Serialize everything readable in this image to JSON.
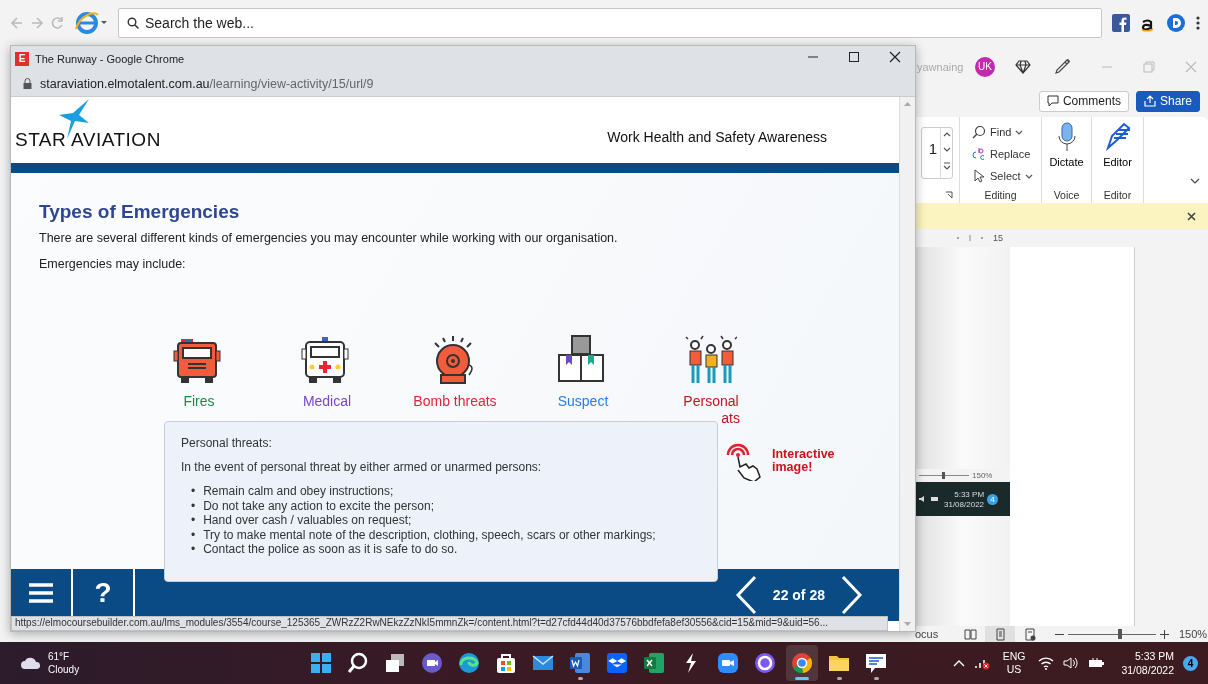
{
  "browser_toolbar": {
    "search": {
      "placeholder": "Search the web..."
    }
  },
  "word": {
    "user": "yawnaing",
    "avatar": "UK",
    "buttons": [
      {
        "label": "Comments",
        "kind": "outline"
      },
      {
        "label": "Share",
        "kind": "primary"
      }
    ],
    "spin_value": "1",
    "editing": {
      "items": [
        {
          "label": "Find",
          "kind": "find",
          "dropdown": true
        },
        {
          "label": "Replace",
          "kind": "replace",
          "dropdown": false
        },
        {
          "label": "Select",
          "kind": "select",
          "dropdown": true
        }
      ],
      "group": "Editing"
    },
    "voice": {
      "label": "Dictate",
      "group": "Voice"
    },
    "editor": {
      "label": "Editor",
      "group": "Editor"
    },
    "ruler_mark": "15",
    "embedded": {
      "zoom": "150%",
      "level": 0.45,
      "time": "5:33 PM",
      "date": "31/08/2022",
      "badge": "4"
    },
    "status": {
      "focus": "ocus",
      "views": [
        {
          "selected": false
        },
        {
          "selected": true
        },
        {
          "selected": false
        }
      ],
      "level": 0.57,
      "zoom": "150%"
    }
  },
  "chrome": {
    "favicon": "E",
    "title": "The Runway - Google Chrome",
    "url_domain": "staraviation.elmotalent.com.au",
    "url_path": "/learning/view-activity/15/url/9",
    "page": {
      "brand": "STAR AVIATION",
      "course_title": "Work Health and Safety Awareness",
      "heading": "Types of Emergencies",
      "paragraphs": [
        "There are several different kinds of emergencies you may encounter while working with our organisation.",
        "Emergencies may include:"
      ],
      "items": [
        {
          "kind": "fire",
          "lines": [
            "Fires"
          ],
          "color": "#1a8a4a"
        },
        {
          "kind": "medical",
          "lines": [
            "Medical"
          ],
          "color": "#7a45c8"
        },
        {
          "kind": "bomb",
          "lines": [
            "Bomb threats"
          ],
          "color": "#e0243c"
        },
        {
          "kind": "suspect",
          "lines": [
            "Suspect"
          ],
          "color": "#2a7de0"
        },
        {
          "kind": "personal",
          "lines": [
            "Personal",
            "ats"
          ],
          "color": "#c21420"
        }
      ],
      "tooltip": {
        "title": "Personal threats:",
        "intro": "In the event of personal threat by either armed or unarmed persons:",
        "bullet": "•",
        "bullets": [
          "Remain calm and obey instructions;",
          "Do not take any action to excite the person;",
          "Hand over cash / valuables on request;",
          "Try to make mental note of the description, clothing, speech, scars or other markings;",
          "Contact the police as soon as it is safe to do so."
        ]
      },
      "interactive": "Interactive image!",
      "nav": {
        "help": "?",
        "page": "22 of 28"
      }
    },
    "status_url": "https://elmocoursebuilder.com.au/lms_modules/3554/course_125365_ZWRzZ2RwNEkzZzNkI5mmnZk=/content.html?t=d27cfd44d40d37576bbdfefa8ef30556&cid=15&mid=9&uid=56..."
  },
  "taskbar": {
    "temp": "61°F",
    "condition": "Cloudy",
    "apps": [
      {
        "kind": "start",
        "running": false,
        "selected": false
      },
      {
        "kind": "search",
        "running": false,
        "selected": false
      },
      {
        "kind": "taskview",
        "running": false,
        "selected": false
      },
      {
        "kind": "teams",
        "running": false,
        "selected": false
      },
      {
        "kind": "edge",
        "running": false,
        "selected": false
      },
      {
        "kind": "store",
        "running": false,
        "selected": false
      },
      {
        "kind": "mail",
        "running": false,
        "selected": false
      },
      {
        "kind": "word",
        "running": true,
        "selected": false
      },
      {
        "kind": "dropbox",
        "running": false,
        "selected": false
      },
      {
        "kind": "excel",
        "running": false,
        "selected": false
      },
      {
        "kind": "bolt",
        "running": false,
        "selected": false
      },
      {
        "kind": "zoom",
        "running": false,
        "selected": false
      },
      {
        "kind": "ring",
        "running": false,
        "selected": false
      },
      {
        "kind": "chrome",
        "running": true,
        "selected": true
      },
      {
        "kind": "folder",
        "running": true,
        "selected": false
      },
      {
        "kind": "feedback",
        "running": true,
        "selected": false
      }
    ],
    "lang": "ENG",
    "region": "US",
    "time": "5:33 PM",
    "date": "31/08/2022",
    "badge": "4"
  }
}
